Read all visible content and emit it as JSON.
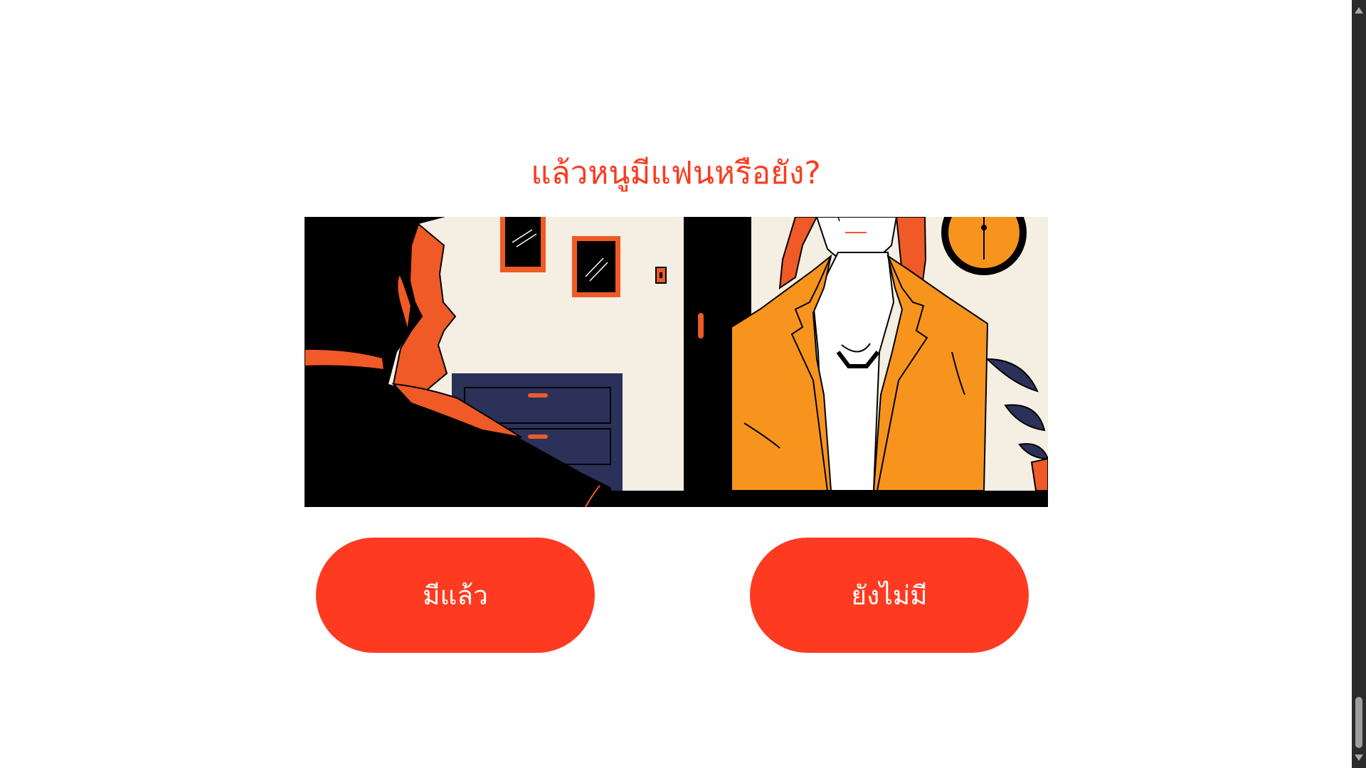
{
  "question": {
    "text": "แล้วหนูมีแฟนหรือยัง?"
  },
  "illustration": {
    "scene": "illustration"
  },
  "choices": {
    "yes_label": "มีแล้ว",
    "no_label": "ยังไม่มี"
  },
  "colors": {
    "accent": "#fe3a20",
    "orange": "#f7941e",
    "navy": "#2b3159",
    "cream": "#f4efe2"
  }
}
